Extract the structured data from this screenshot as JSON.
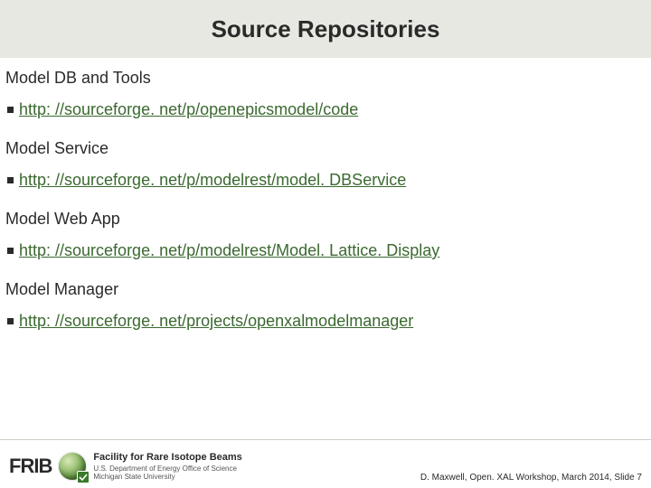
{
  "title": "Source Repositories",
  "sections": [
    {
      "heading": "Model DB and Tools",
      "link": "http: //sourceforge. net/p/openepicsmodel/code"
    },
    {
      "heading": "Model Service",
      "link": "http: //sourceforge. net/p/modelrest/model. DBService"
    },
    {
      "heading": "Model Web App",
      "link": "http: //sourceforge. net/p/modelrest/Model. Lattice. Display"
    },
    {
      "heading": "Model Manager",
      "link": "http: //sourceforge. net/projects/openxalmodelmanager"
    }
  ],
  "footer": {
    "logo_text": "FRIB",
    "facility_title": "Facility for Rare Isotope Beams",
    "facility_line1": "U.S. Department of Energy Office of Science",
    "facility_line2": "Michigan State University",
    "credit": "D. Maxwell, Open. XAL Workshop, March 2014, Slide 7"
  }
}
